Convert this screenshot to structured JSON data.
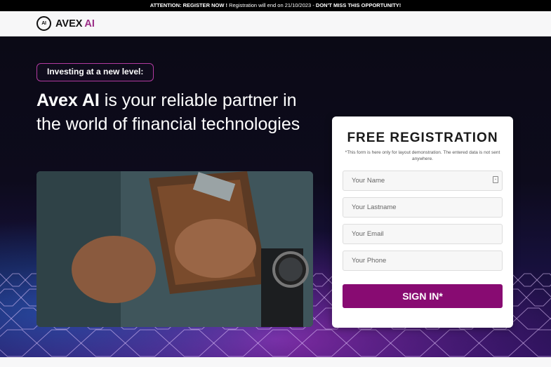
{
  "banner": {
    "strong_lead": "ATTENTION: REGISTER NOW !",
    "middle": " Registration will end on 21/10/2023 - ",
    "strong_tail": "DON'T MISS THIS OPPORTUNITY!"
  },
  "header": {
    "logo_mark": "AI",
    "logo_word": "AVEX",
    "logo_ai": "AI"
  },
  "hero": {
    "pill": "Investing at a new level:",
    "headline_brand": "Avex AI",
    "headline_rest": " is your reliable partner in the world of financial technologies"
  },
  "form": {
    "title": "FREE REGISTRATION",
    "note": "*This form is here only for layout demonstration. The entered data is not sent anywhere.",
    "fields": {
      "name_placeholder": "Your Name",
      "lastname_placeholder": "Your Lastname",
      "email_placeholder": "Your Email",
      "phone_placeholder": "Your Phone"
    },
    "submit": "SIGN IN*"
  },
  "icons": {
    "logo": "avex-ai-logo-icon",
    "field_autofill": "contact-card-icon"
  },
  "colors": {
    "accent": "#880b72",
    "pill_border": "#b13aa0",
    "hero_bg": "#0b0a16"
  }
}
